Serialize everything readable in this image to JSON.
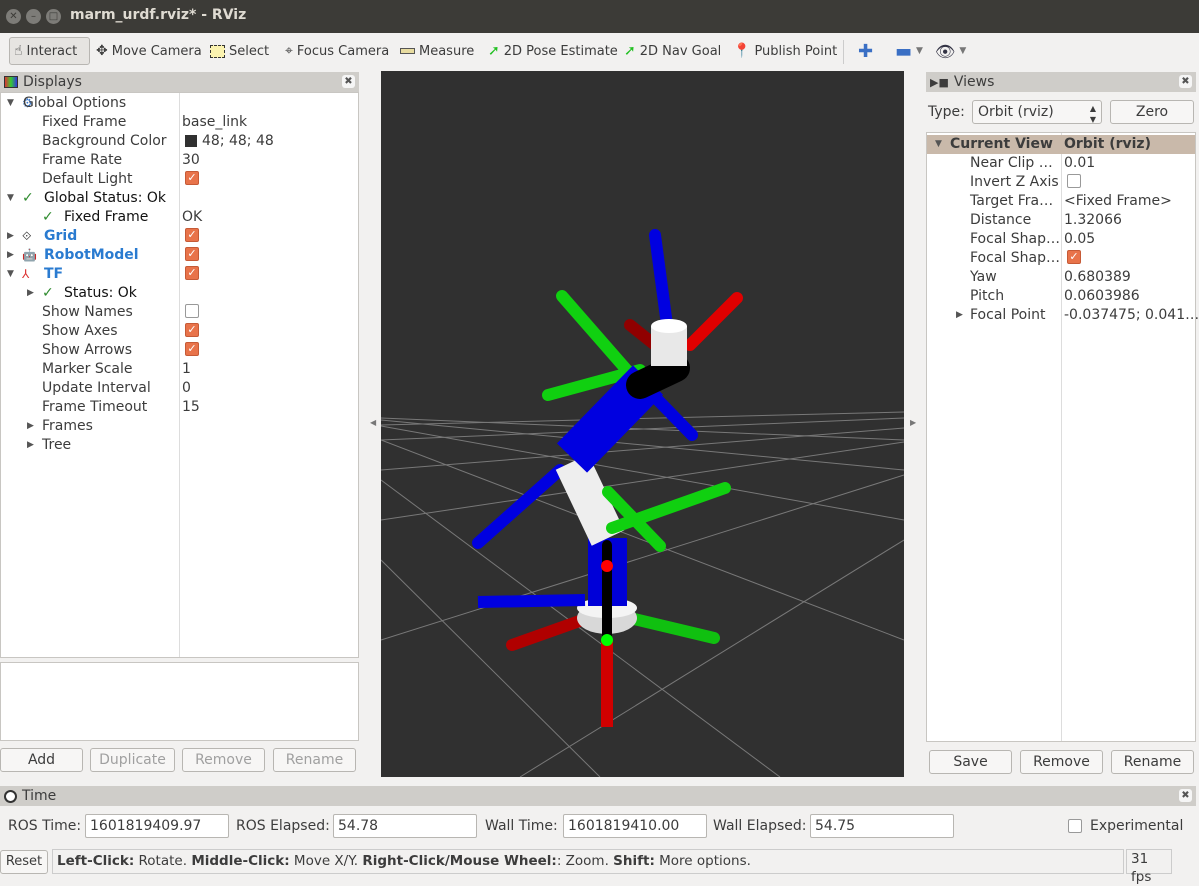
{
  "window": {
    "title": "marm_urdf.rviz* - RViz"
  },
  "toolbar": {
    "tools": [
      {
        "label": "Interact",
        "icon": "hand-pointer-icon"
      },
      {
        "label": "Move Camera",
        "icon": "move-camera-icon"
      },
      {
        "label": "Select",
        "icon": "select-box-icon"
      },
      {
        "label": "Focus Camera",
        "icon": "focus-camera-icon"
      },
      {
        "label": "Measure",
        "icon": "ruler-icon"
      },
      {
        "label": "2D Pose Estimate",
        "icon": "green-arrow-icon"
      },
      {
        "label": "2D Nav Goal",
        "icon": "green-arrow-icon"
      },
      {
        "label": "Publish Point",
        "icon": "map-pin-icon"
      }
    ]
  },
  "displays": {
    "title": "Displays",
    "rows": [
      {
        "label": "Global Options",
        "value": ""
      },
      {
        "label": "Fixed Frame",
        "value": "base_link"
      },
      {
        "label": "Background Color",
        "value": "48; 48; 48"
      },
      {
        "label": "Frame Rate",
        "value": "30"
      },
      {
        "label": "Default Light",
        "value": ""
      },
      {
        "label": "Global Status: Ok",
        "value": ""
      },
      {
        "label": "Fixed Frame",
        "value": "OK"
      },
      {
        "label": "Grid",
        "value": ""
      },
      {
        "label": "RobotModel",
        "value": ""
      },
      {
        "label": "TF",
        "value": ""
      },
      {
        "label": "Status: Ok",
        "value": ""
      },
      {
        "label": "Show Names",
        "value": ""
      },
      {
        "label": "Show Axes",
        "value": ""
      },
      {
        "label": "Show Arrows",
        "value": ""
      },
      {
        "label": "Marker Scale",
        "value": "1"
      },
      {
        "label": "Update Interval",
        "value": "0"
      },
      {
        "label": "Frame Timeout",
        "value": "15"
      },
      {
        "label": "Frames",
        "value": ""
      },
      {
        "label": "Tree",
        "value": ""
      }
    ],
    "background_color": "#303030",
    "buttons": {
      "add": "Add",
      "duplicate": "Duplicate",
      "remove": "Remove",
      "rename": "Rename"
    }
  },
  "views": {
    "title": "Views",
    "type_label": "Type:",
    "type_value": "Orbit (rviz)",
    "zero": "Zero",
    "header": {
      "label": "Current View",
      "value": "Orbit (rviz)"
    },
    "rows": [
      {
        "label": "Near Clip …",
        "value": "0.01"
      },
      {
        "label": "Invert Z Axis",
        "value": ""
      },
      {
        "label": "Target Fra…",
        "value": "<Fixed Frame>"
      },
      {
        "label": "Distance",
        "value": "1.32066"
      },
      {
        "label": "Focal Shap…",
        "value": "0.05"
      },
      {
        "label": "Focal Shap…",
        "value": ""
      },
      {
        "label": "Yaw",
        "value": "0.680389"
      },
      {
        "label": "Pitch",
        "value": "0.0603986"
      },
      {
        "label": "Focal Point",
        "value": "-0.037475; 0.041…"
      }
    ],
    "buttons": {
      "save": "Save",
      "remove": "Remove",
      "rename": "Rename"
    }
  },
  "time": {
    "title": "Time",
    "ros_time_label": "ROS Time:",
    "ros_time": "1601819409.97",
    "ros_elapsed_label": "ROS Elapsed:",
    "ros_elapsed": "54.78",
    "wall_time_label": "Wall Time:",
    "wall_time": "1601819410.00",
    "wall_elapsed_label": "Wall Elapsed:",
    "wall_elapsed": "54.75",
    "experimental": "Experimental"
  },
  "status": {
    "reset": "Reset",
    "hints": [
      {
        "b": "Left-Click:",
        "t": " Rotate. "
      },
      {
        "b": "Middle-Click:",
        "t": " Move X/Y. "
      },
      {
        "b": "Right-Click/Mouse Wheel:",
        "t": ": Zoom. "
      },
      {
        "b": "Shift:",
        "t": " More options."
      }
    ],
    "fps": "31 fps"
  }
}
